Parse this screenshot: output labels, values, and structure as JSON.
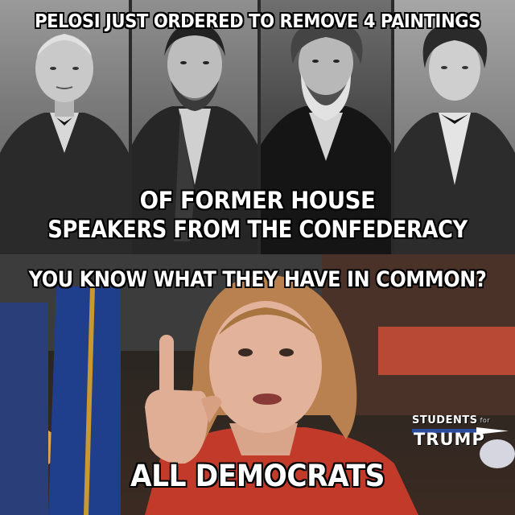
{
  "captions": {
    "top": "PELOSI JUST ORDERED TO REMOVE 4 PAINTINGS",
    "middle_line1": "OF FORMER HOUSE",
    "middle_line2": "SPEAKERS FROM THE CONFEDERACY",
    "question": "YOU KNOW WHAT THEY HAVE IN COMMON?",
    "bottom": "ALL DEMOCRATS"
  },
  "logo": {
    "students": "STUDENTS",
    "for": "for",
    "trump": "TRUMP"
  },
  "colors": {
    "caption_text": "#ffffff",
    "caption_outline": "#000000",
    "flag_blue": "#1f3f8c",
    "jacket_red": "#c23a2a",
    "logo_blue": "#2b4b9b"
  }
}
